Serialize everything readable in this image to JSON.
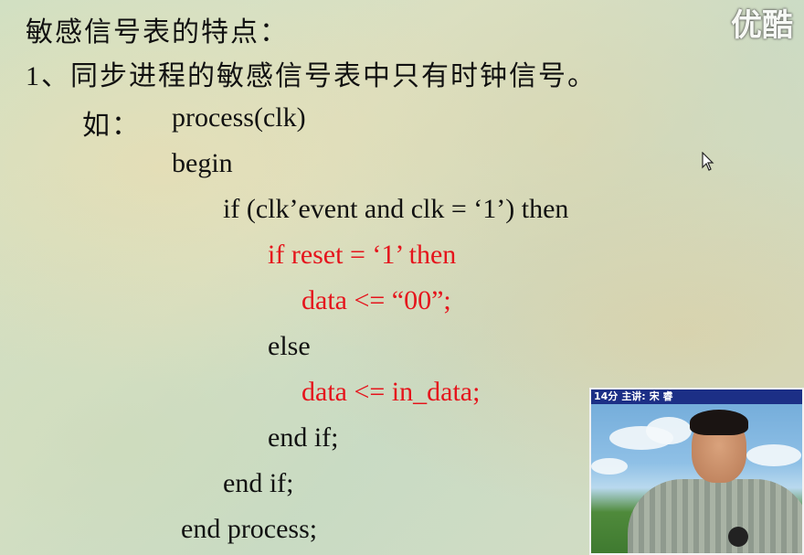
{
  "slide": {
    "title": "敏感信号表的特点：",
    "point1": "1、同步进程的敏感信号表中只有时钟信号。",
    "example_label": "如：",
    "code": {
      "l1": "process(clk)",
      "l2": "begin",
      "l3": "if (clk’event  and  clk = ‘1’)  then",
      "l4": "if  reset = ‘1’  then",
      "l5": "data <= “00”;",
      "l6": "else",
      "l7": "data <= in_data;",
      "l8": "end  if;",
      "l9": "end  if;",
      "l10": "end  process;"
    }
  },
  "watermark": {
    "logo_text": "优酷"
  },
  "video_inset": {
    "caption_time": "14分",
    "caption_label": "主讲:",
    "caption_name": "宋 睿"
  },
  "colors": {
    "code_highlight": "#e5141c",
    "caption_bar": "#1c2f86"
  },
  "icons": {
    "cursor": "mouse-pointer-icon"
  }
}
